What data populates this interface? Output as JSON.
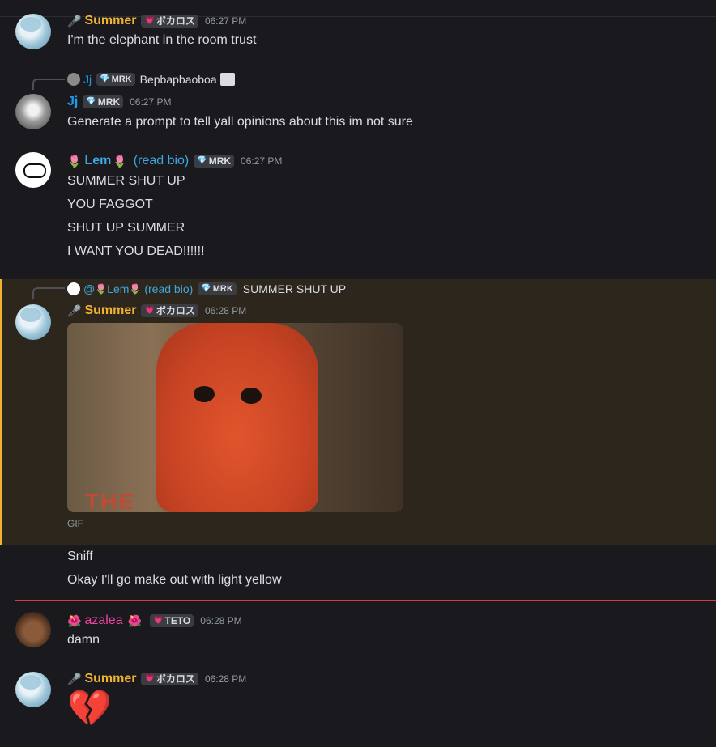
{
  "topbar": {
    "fragment": ""
  },
  "messages": [
    {
      "id": "m1",
      "author": "Summer",
      "author_icon": "microphone",
      "tag": "ボカロス",
      "tag_icon": "pink-heart",
      "time": "06:27 PM",
      "lines": [
        "I'm the elephant in the room trust"
      ]
    },
    {
      "id": "m2",
      "reply": {
        "author": "Jj",
        "tag": "MRK",
        "text": "Bepbapbaoboa",
        "has_image": true
      },
      "author": "Jj",
      "tag": "MRK",
      "tag_icon": "orange-gem",
      "time": "06:27 PM",
      "lines": [
        "Generate a prompt to tell yall opinions about this im not sure"
      ]
    },
    {
      "id": "m3",
      "author_prefix_emoji": "🌷",
      "author": "Lem",
      "author_suffix_emoji": "🌷",
      "author_suffix_text": "(read bio)",
      "tag": "MRK",
      "time": "06:27 PM",
      "lines": [
        "SUMMER SHUT UP",
        "YOU FAGGOT",
        "SHUT UP SUMMER",
        "I WANT YOU DEAD!!!!!!"
      ]
    },
    {
      "id": "m4",
      "reply": {
        "mention": "@",
        "author": "Lem",
        "suffix": "(read bio)",
        "tag": "MRK",
        "text": "SUMMER SHUT UP"
      },
      "author": "Summer",
      "tag": "ボカロス",
      "time": "06:28 PM",
      "gif_label": "GIF",
      "gif_text": "THE"
    },
    {
      "id": "m5",
      "lines": [
        "Sniff",
        "Okay I'll go make out with light yellow"
      ]
    },
    {
      "id": "m6",
      "author_prefix_emoji": "🌺",
      "author": "azalea",
      "author_suffix_emoji": "🌺",
      "tag": "TETO",
      "time": "06:28 PM",
      "lines": [
        "damn"
      ]
    },
    {
      "id": "m7",
      "author": "Summer",
      "tag": "ボカロス",
      "time": "06:28 PM",
      "emoji": "💔"
    }
  ],
  "colors": {
    "accent_highlight": "#f0b232",
    "new_divider": "#e2393d"
  }
}
